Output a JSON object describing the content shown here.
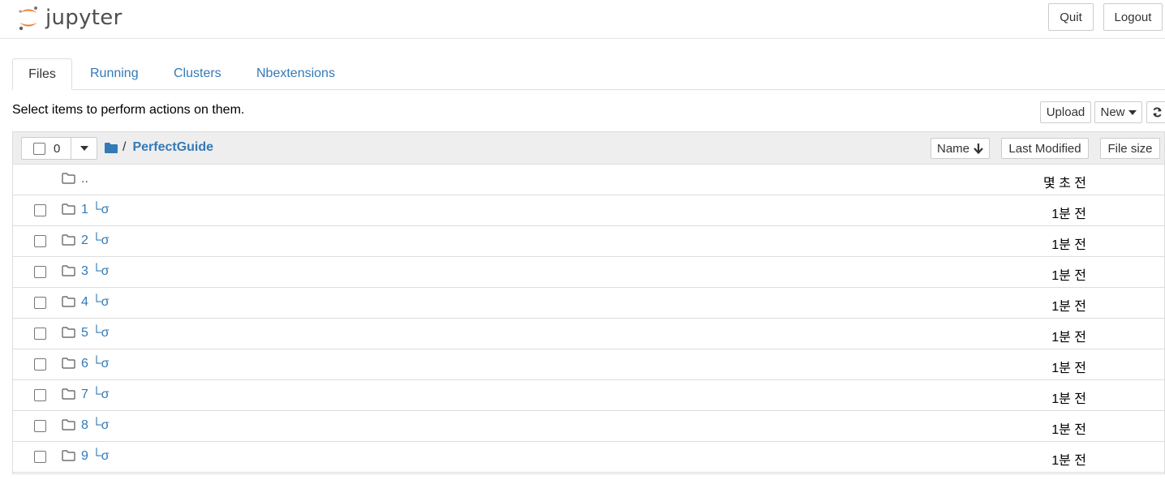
{
  "header": {
    "logo_text": "jupyter",
    "quit_label": "Quit",
    "logout_label": "Logout"
  },
  "tabs": [
    {
      "label": "Files",
      "active": true
    },
    {
      "label": "Running",
      "active": false
    },
    {
      "label": "Clusters",
      "active": false
    },
    {
      "label": "Nbextensions",
      "active": false
    }
  ],
  "toolbar": {
    "hint": "Select items to perform actions on them.",
    "upload_label": "Upload",
    "new_label": "New",
    "refresh_icon": "refresh-icon"
  },
  "list": {
    "selected_count": "0",
    "breadcrumb_separator": "/",
    "current_dir": "PerfectGuide",
    "sort_name_label": "Name",
    "sort_modified_label": "Last Modified",
    "sort_size_label": "File size",
    "parent": {
      "name": "..",
      "modified": "몇 초 전"
    },
    "items": [
      {
        "name": "1 └σ",
        "modified": "1분 전"
      },
      {
        "name": "2 └σ",
        "modified": "1분 전"
      },
      {
        "name": "3 └σ",
        "modified": "1분 전"
      },
      {
        "name": "4 └σ",
        "modified": "1분 전"
      },
      {
        "name": "5 └σ",
        "modified": "1분 전"
      },
      {
        "name": "6 └σ",
        "modified": "1분 전"
      },
      {
        "name": "7 └σ",
        "modified": "1분 전"
      },
      {
        "name": "8 └σ",
        "modified": "1분 전"
      },
      {
        "name": "9 └σ",
        "modified": "1분 전"
      }
    ]
  },
  "colors": {
    "link": "#337ab7",
    "logo_orange": "#f37726",
    "border": "#dddddd"
  }
}
